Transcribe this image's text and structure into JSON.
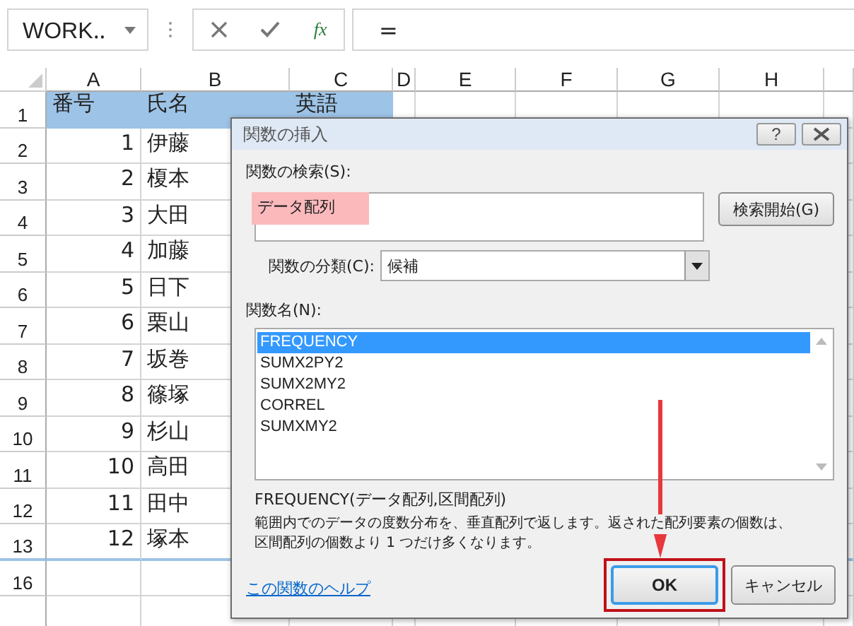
{
  "name_box": "WORK‥",
  "formula_button": "fx",
  "formula": "=",
  "columns": [
    "A",
    "B",
    "C",
    "D",
    "E",
    "F",
    "G",
    "H"
  ],
  "rows": [
    {
      "num": "1",
      "highlighted": true,
      "cells": [
        "番号",
        "氏名",
        "英語"
      ]
    },
    {
      "num": "2",
      "highlighted": false,
      "cells": [
        "1",
        "伊藤",
        ""
      ]
    },
    {
      "num": "3",
      "highlighted": false,
      "cells": [
        "2",
        "榎本",
        ""
      ]
    },
    {
      "num": "4",
      "highlighted": false,
      "cells": [
        "3",
        "大田",
        ""
      ]
    },
    {
      "num": "5",
      "highlighted": false,
      "cells": [
        "4",
        "加藤",
        ""
      ]
    },
    {
      "num": "6",
      "highlighted": false,
      "cells": [
        "5",
        "日下",
        ""
      ]
    },
    {
      "num": "7",
      "highlighted": false,
      "cells": [
        "6",
        "栗山",
        ""
      ]
    },
    {
      "num": "8",
      "highlighted": false,
      "cells": [
        "7",
        "坂巻",
        ""
      ]
    },
    {
      "num": "9",
      "highlighted": false,
      "cells": [
        "8",
        "篠塚",
        ""
      ]
    },
    {
      "num": "10",
      "highlighted": false,
      "cells": [
        "9",
        "杉山",
        ""
      ]
    },
    {
      "num": "11",
      "highlighted": false,
      "cells": [
        "10",
        "高田",
        ""
      ]
    },
    {
      "num": "12",
      "highlighted": false,
      "cells": [
        "11",
        "田中",
        ""
      ]
    },
    {
      "num": "13",
      "highlighted": false,
      "cells": [
        "12",
        "塚本",
        ""
      ]
    },
    {
      "num": "16",
      "highlighted": false,
      "cells": [
        "",
        "",
        ""
      ]
    }
  ],
  "dialog": {
    "title": "関数の挿入",
    "help_button": "?",
    "search_label": "関数の検索(S):",
    "search_value": "データ配列",
    "search_button": "検索開始(G)",
    "category_label": "関数の分類(C):",
    "category_value": "候補",
    "list_label": "関数名(N):",
    "functions": [
      {
        "name": "FREQUENCY",
        "selected": true
      },
      {
        "name": "SUMX2PY2",
        "selected": false
      },
      {
        "name": "SUMX2MY2",
        "selected": false
      },
      {
        "name": "CORREL",
        "selected": false
      },
      {
        "name": "SUMXMY2",
        "selected": false
      }
    ],
    "signature": "FREQUENCY(データ配列,区間配列)",
    "description": [
      "範囲内でのデータの度数分布を、垂直配列で返します。返された配列要素の個数は、",
      "区間配列の個数より 1 つだけ多くなります。"
    ],
    "help_link": "この関数のヘルプ",
    "ok_button": "OK",
    "cancel_button": "キャンセル"
  }
}
